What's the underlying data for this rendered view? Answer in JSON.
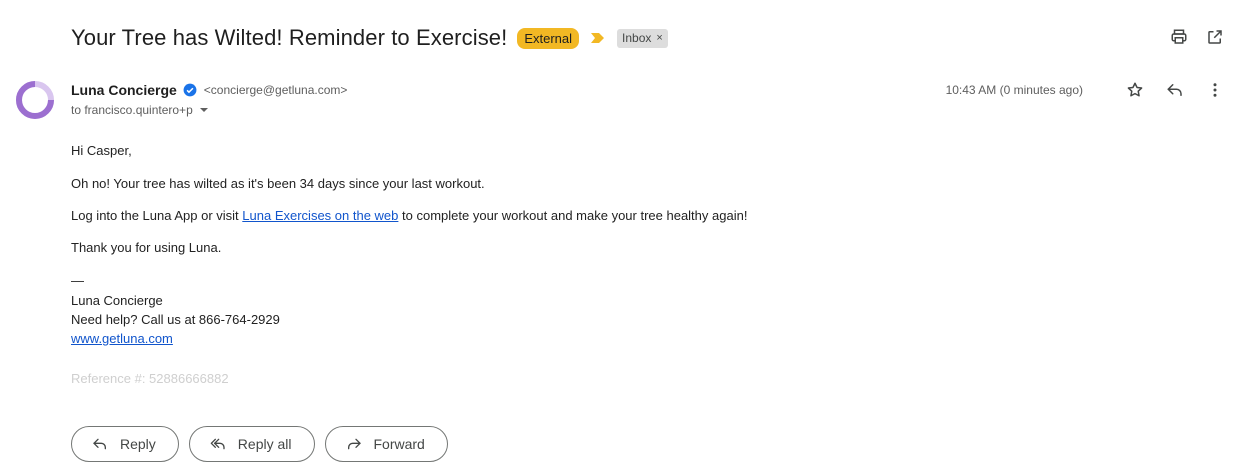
{
  "email": {
    "subject": "Your Tree has Wilted! Reminder to Exercise!",
    "badge_external": "External",
    "label_inbox": "Inbox",
    "label_remove": "×",
    "sender": {
      "name": "Luna Concierge",
      "email": "<concierge@getluna.com>",
      "to": "to francisco.quintero+p",
      "timestamp": "10:43 AM (0 minutes ago)"
    },
    "body": {
      "greeting": "Hi Casper,",
      "line1": "Oh no! Your tree has wilted as it's been 34 days since your last workout.",
      "line2_before": "Log into the Luna App or visit ",
      "line2_link": "Luna Exercises on the web",
      "line2_after": " to complete your workout and make your tree healthy again!",
      "thanks": "Thank you for using Luna.",
      "dash": "—",
      "sig_name": "Luna Concierge",
      "sig_help": "Need help? Call us at 866-764-2929",
      "sig_link": "www.getluna.com",
      "reference": "Reference #: 52886666882"
    },
    "actions": {
      "reply": "Reply",
      "reply_all": "Reply all",
      "forward": "Forward"
    }
  },
  "icons": {
    "print": "print-icon",
    "open_new_window": "open-in-new-window-icon",
    "star": "star-icon",
    "reply": "reply-icon",
    "more": "more-vert-icon",
    "verified": "verified-badge-icon",
    "importance": "importance-marker-icon",
    "caret": "caret-down-icon"
  },
  "colors": {
    "external_badge": "#f2b824",
    "importance_marker": "#f2b824",
    "link": "#1155cc",
    "verified": "#1a73e8",
    "avatar_ring": "#9c6fd0"
  }
}
